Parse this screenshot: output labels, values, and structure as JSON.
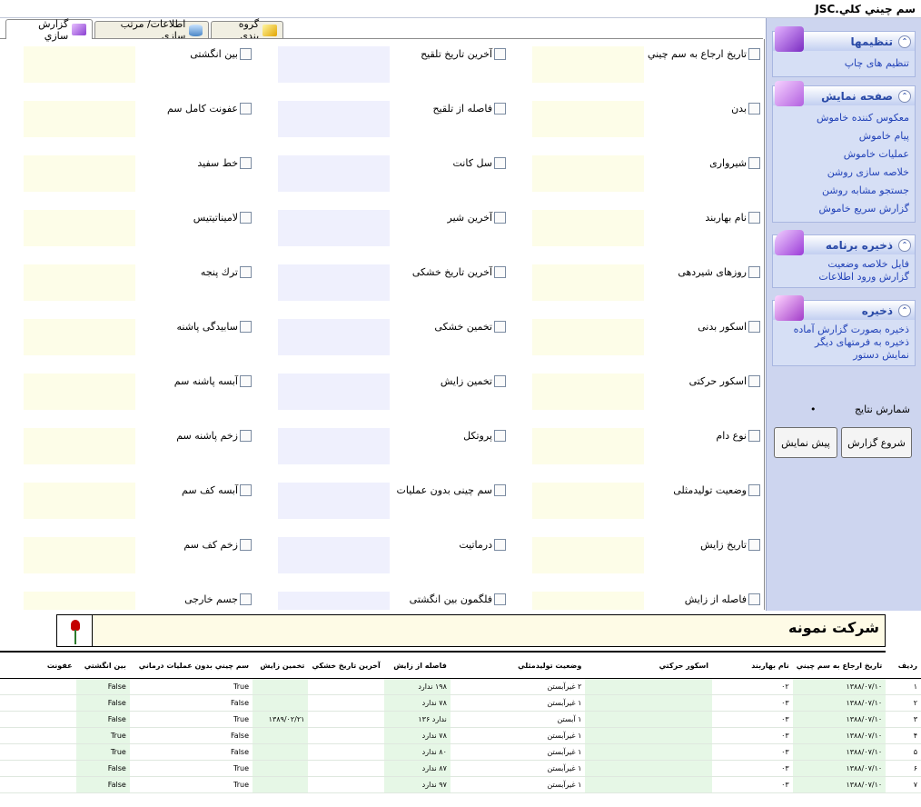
{
  "window": {
    "title": "سم چيني كلي.JSC"
  },
  "tabs": [
    {
      "label": "گزارش سازي",
      "icon": "report-icon",
      "active": true
    },
    {
      "label": "اطلاعات/ مرتب سازي",
      "icon": "database-icon",
      "active": false
    },
    {
      "label": "گروه بندي",
      "icon": "pencil-icon",
      "active": false
    }
  ],
  "fields": {
    "col1": [
      "تاريخ ارجاع به سم چيني",
      "بدن",
      "شيروارى",
      "نام بهاربند",
      "روزهاى شيردهى",
      "اسكور بدنى",
      "اسكور حركتى",
      "نوع دام",
      "وضعيت توليدمثلى",
      "تاريخ زايش",
      "فاصله از زايش"
    ],
    "col2": [
      "آخرين تاريخ تلقيح",
      "فاصله از تلقيح",
      "سل كانت",
      "آخرين شير",
      "آخرين تاريخ خشكى",
      "تخمين خشكى",
      "تخمين زايش",
      "پروتكل",
      "سم چينى بدون عمليات",
      "درماتيت",
      "فلگمون بين انگشتى"
    ],
    "col3": [
      "بين انگشتى",
      "عفونت كامل سم",
      "خط سفيد",
      "لاميناتيتيس",
      "ترك پنجه",
      "سابيدگى پاشنه",
      "آبسه پاشنه سم",
      "زخم پاشنه سم",
      "آبسه كف سم",
      "زخم كف سم",
      "جسم خارجى"
    ]
  },
  "panel": {
    "settings": {
      "title": "تنظيمها",
      "icon": "settings-icon",
      "links": [
        "تنظيم هاى چاپ"
      ]
    },
    "display": {
      "title": "صفحه نمايش",
      "icon": "display-icon",
      "links": [
        "معكوس كننده خاموش",
        "پيام خاموش",
        "عمليات خاموش",
        "خلاصه سازى روشن",
        "جستجو مشابه روشن",
        "گزارش سريع خاموش"
      ]
    },
    "save_program": {
      "title": "ذخيره برنامه",
      "icon": "save-program-icon",
      "links": [
        "فايل خلاصه وضعيت",
        "گزارش ورود اطلاعات"
      ]
    },
    "save": {
      "title": "ذخيره",
      "icon": "save-icon",
      "links": [
        "ذخيره بصورت گزارش آماده",
        "ذخيره به فرمتهاى ديگر",
        "نمايش دستور"
      ]
    },
    "results_label": "شمارش نتايج",
    "results_value": "•",
    "start_button": "شروع گزارش",
    "preview_button": "پيش نمايش"
  },
  "report": {
    "company": "شركت نمونه",
    "columns": [
      "رديف",
      "تاريخ ارجاع به سم چيني",
      "نام بهاربند",
      "اسكور حركتي",
      "وضعيت توليدمثلي",
      "فاصله از زايش",
      "آخرين تاريخ خشكي",
      "تخمين زايش",
      "سم چيني بدون عمليات درماني",
      "بين انگشتي",
      "عفونت"
    ],
    "rows": [
      [
        "١",
        "١٣٨٨/٠٧/١٠",
        "٠٢",
        "٢ غيرآبستن",
        "١٩٨ ندارد",
        "",
        "",
        "True",
        "False",
        ""
      ],
      [
        "٢",
        "١٣٨٨/٠٧/١٠",
        "٠٣",
        "١ غيرآبستن",
        "٧٨ ندارد",
        "",
        "",
        "False",
        "False",
        ""
      ],
      [
        "٣",
        "١٣٨٨/٠٧/١٠",
        "٠٣",
        "١ آبستن",
        "١٣۶ ندارد",
        "",
        "١٣٨٩/٠٢/٢١",
        "True",
        "False",
        ""
      ],
      [
        "۴",
        "١٣٨٨/٠٧/١٠",
        "٠٣",
        "١ غيرآبستن",
        "٧٨ ندارد",
        "",
        "",
        "False",
        "True",
        ""
      ],
      [
        "۵",
        "١٣٨٨/٠٧/١٠",
        "٠٣",
        "١ غيرآبستن",
        "٨٠ ندارد",
        "",
        "",
        "False",
        "True",
        ""
      ],
      [
        "۶",
        "١٣٨٨/٠٧/١٠",
        "٠٣",
        "١ غيرآبستن",
        "٨٧ ندارد",
        "",
        "",
        "True",
        "False",
        ""
      ],
      [
        "٧",
        "١٣٨٨/٠٧/١٠",
        "٠٣",
        "١ غيرآبستن",
        "٩٧ ندارد",
        "",
        "",
        "True",
        "False",
        ""
      ]
    ]
  }
}
